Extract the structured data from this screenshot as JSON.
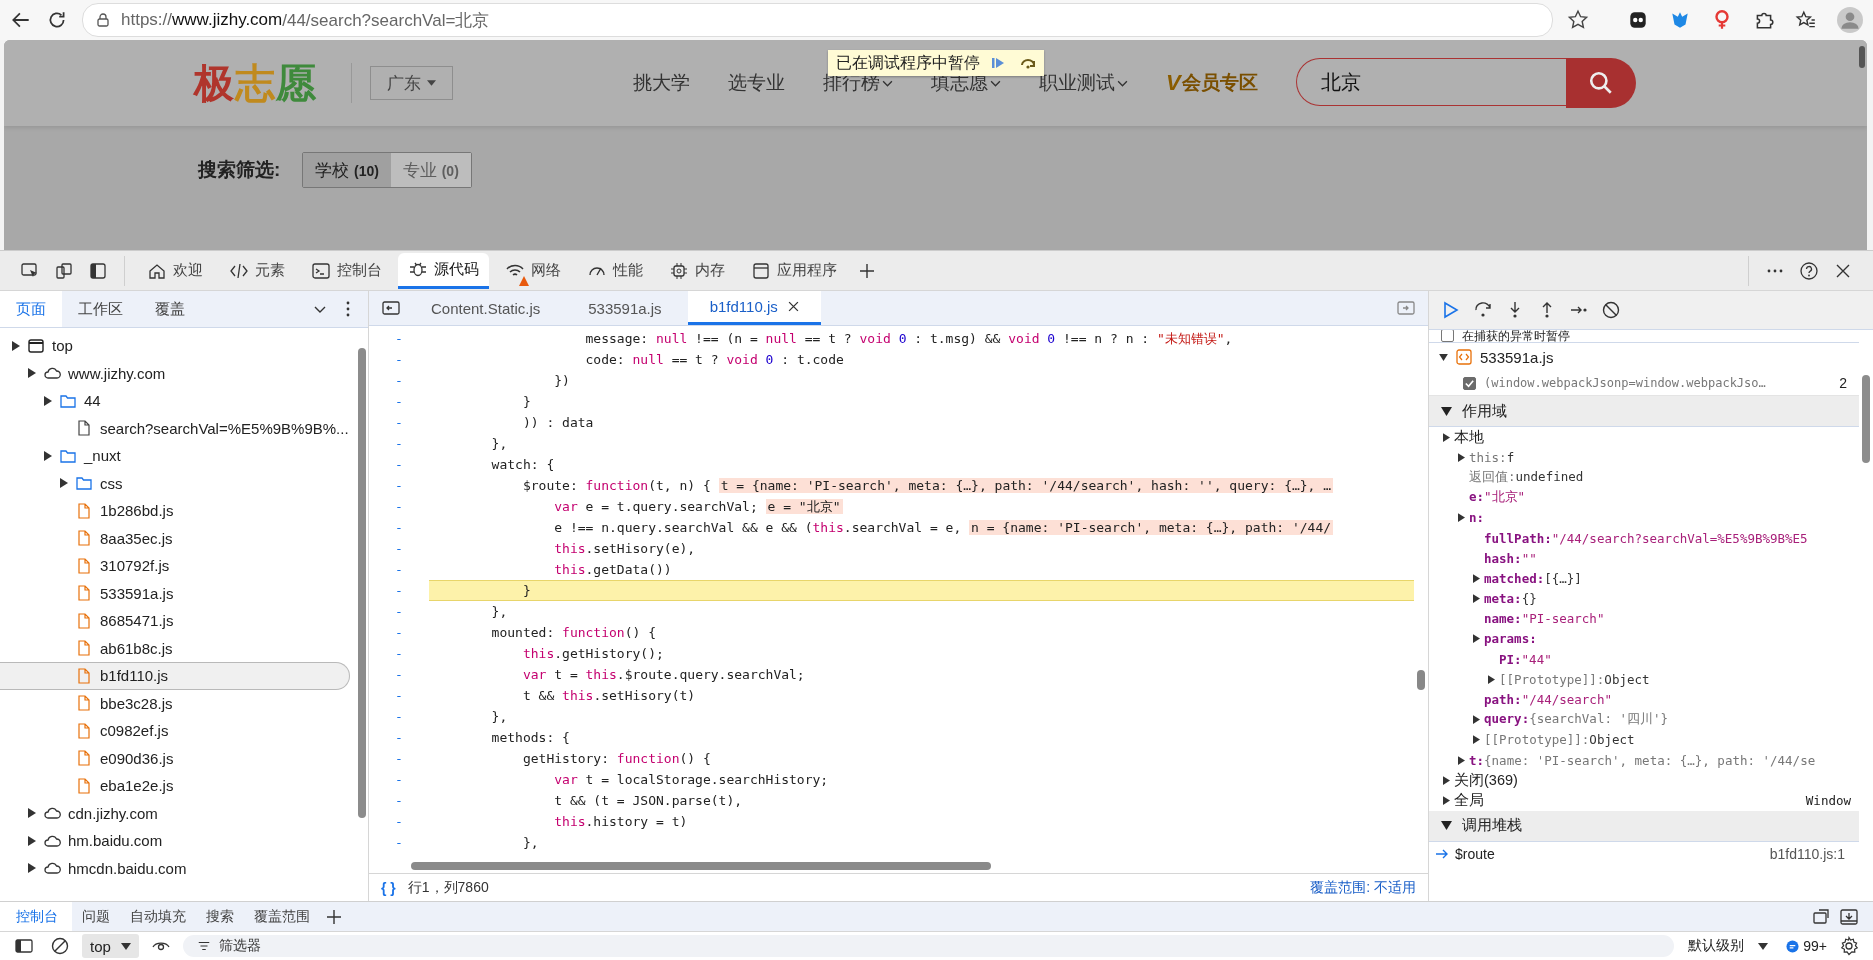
{
  "browser": {
    "url_scheme": "https://",
    "url_host": "www.jizhy.com",
    "url_path": "/44/search?searchVal=北京"
  },
  "site": {
    "logo": [
      {
        "char": "极",
        "color": "#b0352c"
      },
      {
        "char": "志",
        "color": "#c08a1e"
      },
      {
        "char": "愿",
        "color": "#3f8a3c"
      }
    ],
    "province": "广东",
    "nav": [
      {
        "label": "挑大学",
        "dropdown": false
      },
      {
        "label": "选专业",
        "dropdown": false
      },
      {
        "label": "排行榜",
        "dropdown": true
      },
      {
        "label": "填志愿",
        "dropdown": true
      },
      {
        "label": "职业测试",
        "dropdown": true
      }
    ],
    "vip": {
      "mark": "V",
      "label": "会员专区"
    },
    "search": {
      "value": "北京"
    },
    "paused": {
      "text": "已在调试程序中暂停"
    },
    "filter": {
      "label": "搜索筛选:",
      "options": [
        {
          "label": "学校",
          "count": "(10)",
          "selected": true
        },
        {
          "label": "专业",
          "count": "(0)",
          "selected": false
        }
      ]
    }
  },
  "devtools": {
    "tabs": [
      {
        "label": "欢迎",
        "selected": false,
        "warning": false
      },
      {
        "label": "元素",
        "selected": false,
        "warning": false
      },
      {
        "label": "控制台",
        "selected": false,
        "warning": false
      },
      {
        "label": "源代码",
        "selected": true,
        "warning": false
      },
      {
        "label": "网络",
        "selected": false,
        "warning": true
      },
      {
        "label": "性能",
        "selected": false,
        "warning": false
      },
      {
        "label": "内存",
        "selected": false,
        "warning": false
      },
      {
        "label": "应用程序",
        "selected": false,
        "warning": false
      }
    ],
    "navigator": {
      "tabs": [
        {
          "label": "页面",
          "selected": true
        },
        {
          "label": "工作区",
          "selected": false
        },
        {
          "label": "覆盖",
          "selected": false
        }
      ],
      "tree": [
        {
          "label": "top",
          "kind": "frame",
          "selected": false,
          "children": [
            {
              "label": "www.jizhy.com",
              "kind": "domain",
              "selected": false,
              "children": [
                {
                  "label": "44",
                  "kind": "folder",
                  "selected": false,
                  "children": [
                    {
                      "label": "search?searchVal=%E5%9B%9B%...",
                      "kind": "document",
                      "selected": false
                    }
                  ]
                },
                {
                  "label": "_nuxt",
                  "kind": "folder",
                  "selected": false,
                  "children": [
                    {
                      "label": "css",
                      "kind": "folder",
                      "selected": false
                    },
                    {
                      "label": "1b286bd.js",
                      "kind": "script",
                      "selected": false
                    },
                    {
                      "label": "8aa35ec.js",
                      "kind": "script",
                      "selected": false
                    },
                    {
                      "label": "310792f.js",
                      "kind": "script",
                      "selected": false
                    },
                    {
                      "label": "533591a.js",
                      "kind": "script",
                      "selected": false
                    },
                    {
                      "label": "8685471.js",
                      "kind": "script",
                      "selected": false
                    },
                    {
                      "label": "ab61b8c.js",
                      "kind": "script",
                      "selected": false
                    },
                    {
                      "label": "b1fd110.js",
                      "kind": "script",
                      "selected": true
                    },
                    {
                      "label": "bbe3c28.js",
                      "kind": "script",
                      "selected": false
                    },
                    {
                      "label": "c0982ef.js",
                      "kind": "script",
                      "selected": false
                    },
                    {
                      "label": "e090d36.js",
                      "kind": "script",
                      "selected": false
                    },
                    {
                      "label": "eba1e2e.js",
                      "kind": "script",
                      "selected": false
                    }
                  ]
                }
              ]
            },
            {
              "label": "cdn.jizhy.com",
              "kind": "domain",
              "selected": false
            },
            {
              "label": "hm.baidu.com",
              "kind": "domain",
              "selected": false
            },
            {
              "label": "hmcdn.baidu.com",
              "kind": "domain",
              "selected": false
            }
          ]
        }
      ]
    },
    "editor": {
      "tabs": [
        {
          "label": "Content.Static.js",
          "selected": false
        },
        {
          "label": "533591a.js",
          "selected": false
        },
        {
          "label": "b1fd110.js",
          "selected": true
        }
      ],
      "lines": [
        {
          "marker": "-",
          "current": false,
          "tokens": [
            {
              "text": "                    message: ",
              "kind": "plain"
            },
            {
              "text": "null",
              "kind": "keyword"
            },
            {
              "text": " !== (n = ",
              "kind": "plain"
            },
            {
              "text": "null",
              "kind": "keyword"
            },
            {
              "text": " == t ? ",
              "kind": "plain"
            },
            {
              "text": "void",
              "kind": "keyword"
            },
            {
              "text": " 0",
              "kind": "number"
            },
            {
              "text": " : t.msg) && ",
              "kind": "plain"
            },
            {
              "text": "void",
              "kind": "keyword"
            },
            {
              "text": " 0",
              "kind": "number"
            },
            {
              "text": " !== n ? n : ",
              "kind": "plain"
            },
            {
              "text": "\"未知错误\"",
              "kind": "string"
            },
            {
              "text": ",",
              "kind": "plain"
            }
          ]
        },
        {
          "marker": "-",
          "current": false,
          "tokens": [
            {
              "text": "                    code: ",
              "kind": "plain"
            },
            {
              "text": "null",
              "kind": "keyword"
            },
            {
              "text": " == t ? ",
              "kind": "plain"
            },
            {
              "text": "void",
              "kind": "keyword"
            },
            {
              "text": " 0",
              "kind": "number"
            },
            {
              "text": " : t.code",
              "kind": "plain"
            }
          ]
        },
        {
          "marker": "-",
          "current": false,
          "tokens": [
            {
              "text": "                })",
              "kind": "plain"
            }
          ]
        },
        {
          "marker": "-",
          "current": false,
          "tokens": [
            {
              "text": "            }",
              "kind": "plain"
            }
          ]
        },
        {
          "marker": "-",
          "current": false,
          "tokens": [
            {
              "text": "            )) : data",
              "kind": "plain"
            }
          ]
        },
        {
          "marker": "-",
          "current": false,
          "tokens": [
            {
              "text": "        },",
              "kind": "plain"
            }
          ]
        },
        {
          "marker": "-",
          "current": false,
          "tokens": [
            {
              "text": "        watch: {",
              "kind": "plain"
            }
          ]
        },
        {
          "marker": "-",
          "current": false,
          "tokens": [
            {
              "text": "            $route: ",
              "kind": "plain"
            },
            {
              "text": "function",
              "kind": "keyword"
            },
            {
              "text": "(t, n) { ",
              "kind": "plain"
            },
            {
              "text": "t = {name: 'PI-search', meta: {…}, path: '/44/search', hash: '', query: {…}, …",
              "kind": "inline"
            }
          ]
        },
        {
          "marker": "-",
          "current": false,
          "tokens": [
            {
              "text": "                var",
              "kind": "keyword"
            },
            {
              "text": " e = t.query.searchVal; ",
              "kind": "plain"
            },
            {
              "text": "e = \"北京\"",
              "kind": "inline"
            }
          ]
        },
        {
          "marker": "-",
          "current": false,
          "tokens": [
            {
              "text": "                e !== n.query.searchVal && e && (",
              "kind": "plain"
            },
            {
              "text": "this",
              "kind": "keyword"
            },
            {
              "text": ".searchVal = e, ",
              "kind": "plain"
            },
            {
              "text": "n = {name: 'PI-search', meta: {…}, path: '/44/",
              "kind": "inline"
            }
          ]
        },
        {
          "marker": "-",
          "current": false,
          "tokens": [
            {
              "text": "                this",
              "kind": "keyword"
            },
            {
              "text": ".setHisory(e),",
              "kind": "plain"
            }
          ]
        },
        {
          "marker": "-",
          "current": false,
          "tokens": [
            {
              "text": "                this",
              "kind": "keyword"
            },
            {
              "text": ".getData())",
              "kind": "plain"
            }
          ]
        },
        {
          "marker": "-",
          "current": true,
          "tokens": [
            {
              "text": "            }",
              "kind": "plain"
            }
          ]
        },
        {
          "marker": "-",
          "current": false,
          "tokens": [
            {
              "text": "        },",
              "kind": "plain"
            }
          ]
        },
        {
          "marker": "-",
          "current": false,
          "tokens": [
            {
              "text": "        mounted: ",
              "kind": "plain"
            },
            {
              "text": "function",
              "kind": "keyword"
            },
            {
              "text": "() {",
              "kind": "plain"
            }
          ]
        },
        {
          "marker": "-",
          "current": false,
          "tokens": [
            {
              "text": "            this",
              "kind": "keyword"
            },
            {
              "text": ".getHistory();",
              "kind": "plain"
            }
          ]
        },
        {
          "marker": "-",
          "current": false,
          "tokens": [
            {
              "text": "            var",
              "kind": "keyword"
            },
            {
              "text": " t = ",
              "kind": "plain"
            },
            {
              "text": "this",
              "kind": "keyword"
            },
            {
              "text": ".$route.query.searchVal;",
              "kind": "plain"
            }
          ]
        },
        {
          "marker": "-",
          "current": false,
          "tokens": [
            {
              "text": "            t && ",
              "kind": "plain"
            },
            {
              "text": "this",
              "kind": "keyword"
            },
            {
              "text": ".setHisory(t)",
              "kind": "plain"
            }
          ]
        },
        {
          "marker": "-",
          "current": false,
          "tokens": [
            {
              "text": "        },",
              "kind": "plain"
            }
          ]
        },
        {
          "marker": "-",
          "current": false,
          "tokens": [
            {
              "text": "        methods: {",
              "kind": "plain"
            }
          ]
        },
        {
          "marker": "-",
          "current": false,
          "tokens": [
            {
              "text": "            getHistory: ",
              "kind": "plain"
            },
            {
              "text": "function",
              "kind": "keyword"
            },
            {
              "text": "() {",
              "kind": "plain"
            }
          ]
        },
        {
          "marker": "-",
          "current": false,
          "tokens": [
            {
              "text": "                var",
              "kind": "keyword"
            },
            {
              "text": " t = localStorage.searchHistory;",
              "kind": "plain"
            }
          ]
        },
        {
          "marker": "-",
          "current": false,
          "tokens": [
            {
              "text": "                t && (t = JSON.parse(t),",
              "kind": "plain"
            }
          ]
        },
        {
          "marker": "-",
          "current": false,
          "tokens": [
            {
              "text": "                this",
              "kind": "keyword"
            },
            {
              "text": ".history = t)",
              "kind": "plain"
            }
          ]
        },
        {
          "marker": "-",
          "current": false,
          "tokens": [
            {
              "text": "            },",
              "kind": "plain"
            }
          ]
        }
      ],
      "status": {
        "format": "{ }",
        "position": "行1，列7860",
        "coverage": "覆盖范围: 不适用"
      }
    },
    "debugger": {
      "pause_on_caught": {
        "label": "在捕获的异常时暂停",
        "checked": false
      },
      "breakpoints": [
        {
          "file": "533591a.js",
          "code": "(window.webpackJsonp=window.webpackJso…",
          "line": "2",
          "checked": true
        }
      ],
      "scope_title": "作用域",
      "scope": [
        {
          "key": "本地",
          "kind": "section",
          "expandable": true,
          "children": [
            {
              "key": "this:",
              "value": {
                "text": "f",
                "kind": "plain"
              },
              "kind": "internal",
              "expandable": true
            },
            {
              "key": "返回值:",
              "value": {
                "text": "undefined",
                "kind": "plain"
              },
              "kind": "internal",
              "expandable": false
            },
            {
              "key": "e:",
              "value": {
                "text": "\"北京\"",
                "kind": "string"
              },
              "kind": "own",
              "expandable": false
            },
            {
              "key": "n:",
              "kind": "own",
              "expandable": true,
              "children": [
                {
                  "key": "fullPath:",
                  "value": {
                    "text": "\"/44/search?searchVal=%E5%9B%9B%E5",
                    "kind": "string"
                  },
                  "kind": "own",
                  "expandable": false
                },
                {
                  "key": "hash:",
                  "value": {
                    "text": "\"\"",
                    "kind": "string"
                  },
                  "kind": "own",
                  "expandable": false
                },
                {
                  "key": "matched:",
                  "value": {
                    "text": "[{…}]",
                    "kind": "plain"
                  },
                  "kind": "own",
                  "expandable": true
                },
                {
                  "key": "meta:",
                  "value": {
                    "text": "{}",
                    "kind": "plain"
                  },
                  "kind": "own",
                  "expandable": true
                },
                {
                  "key": "name:",
                  "value": {
                    "text": "\"PI-search\"",
                    "kind": "string"
                  },
                  "kind": "own",
                  "expandable": false
                },
                {
                  "key": "params:",
                  "kind": "own",
                  "expandable": true,
                  "children": [
                    {
                      "key": "PI:",
                      "value": {
                        "text": "\"44\"",
                        "kind": "string"
                      },
                      "kind": "own",
                      "expandable": false
                    },
                    {
                      "key": "[[Prototype]]:",
                      "value": {
                        "text": "Object",
                        "kind": "plain"
                      },
                      "kind": "internal",
                      "expandable": true
                    }
                  ]
                },
                {
                  "key": "path:",
                  "value": {
                    "text": "\"/44/search\"",
                    "kind": "string"
                  },
                  "kind": "own",
                  "expandable": false
                },
                {
                  "key": "query:",
                  "value": {
                    "text": "{searchVal: '四川'}",
                    "kind": "preview"
                  },
                  "kind": "own",
                  "expandable": true
                },
                {
                  "key": "[[Prototype]]:",
                  "value": {
                    "text": "Object",
                    "kind": "plain"
                  },
                  "kind": "internal",
                  "expandable": true
                }
              ]
            },
            {
              "key": "t:",
              "value": {
                "text": "{name: 'PI-search', meta: {…}, path: '/44/se",
                "kind": "preview"
              },
              "kind": "own",
              "expandable": true
            }
          ]
        },
        {
          "key": "关闭(369)",
          "kind": "section",
          "expandable": true
        },
        {
          "key": "全局",
          "kind": "section",
          "expandable": true,
          "right": "Window"
        }
      ],
      "callstack_title": "调用堆栈",
      "frames": [
        {
          "name": "$route",
          "location": "b1fd110.js:1",
          "current": true
        }
      ]
    },
    "drawer": {
      "tabs": [
        {
          "label": "控制台",
          "selected": true
        },
        {
          "label": "问题",
          "selected": false
        },
        {
          "label": "自动填充",
          "selected": false
        },
        {
          "label": "搜索",
          "selected": false
        },
        {
          "label": "覆盖范围",
          "selected": false
        }
      ],
      "context": "top",
      "filter_placeholder": "筛选器",
      "level": "默认级别",
      "issues": "99+"
    }
  }
}
